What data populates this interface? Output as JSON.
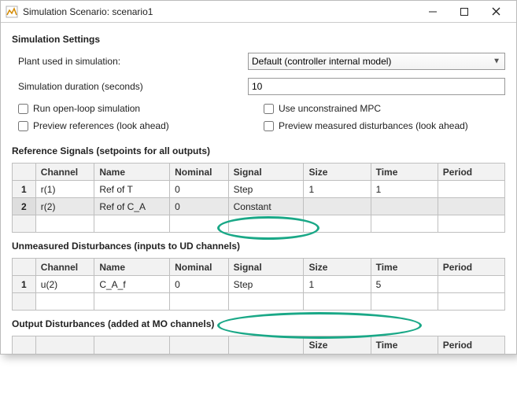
{
  "window": {
    "title": "Simulation Scenario: scenario1"
  },
  "section": {
    "settings_title": "Simulation Settings",
    "plant_label": "Plant used in simulation:",
    "plant_value": "Default (controller internal model)",
    "duration_label": "Simulation duration (seconds)",
    "duration_value": "10",
    "chk_openloop": "Run open-loop simulation",
    "chk_unconstrained": "Use unconstrained MPC",
    "chk_preview_refs": "Preview references (look ahead)",
    "chk_preview_md": "Preview measured disturbances (look ahead)"
  },
  "ref": {
    "title": "Reference Signals (setpoints for all outputs)",
    "headers": {
      "channel": "Channel",
      "name": "Name",
      "nominal": "Nominal",
      "signal": "Signal",
      "size": "Size",
      "time": "Time",
      "period": "Period"
    },
    "rows": [
      {
        "idx": "1",
        "channel": "r(1)",
        "name": "Ref of T",
        "nominal": "0",
        "signal": "Step",
        "size": "1",
        "time": "1",
        "period": ""
      },
      {
        "idx": "2",
        "channel": "r(2)",
        "name": "Ref of C_A",
        "nominal": "0",
        "signal": "Constant",
        "size": "",
        "time": "",
        "period": ""
      }
    ]
  },
  "ud": {
    "title": "Unmeasured Disturbances (inputs to UD channels)",
    "headers": {
      "channel": "Channel",
      "name": "Name",
      "nominal": "Nominal",
      "signal": "Signal",
      "size": "Size",
      "time": "Time",
      "period": "Period"
    },
    "rows": [
      {
        "idx": "1",
        "channel": "u(2)",
        "name": "C_A_f",
        "nominal": "0",
        "signal": "Step",
        "size": "1",
        "time": "5",
        "period": ""
      }
    ]
  },
  "od": {
    "title": "Output Disturbances (added at MO channels)",
    "headers": {
      "size": "Size",
      "time": "Time",
      "period": "Period"
    }
  }
}
